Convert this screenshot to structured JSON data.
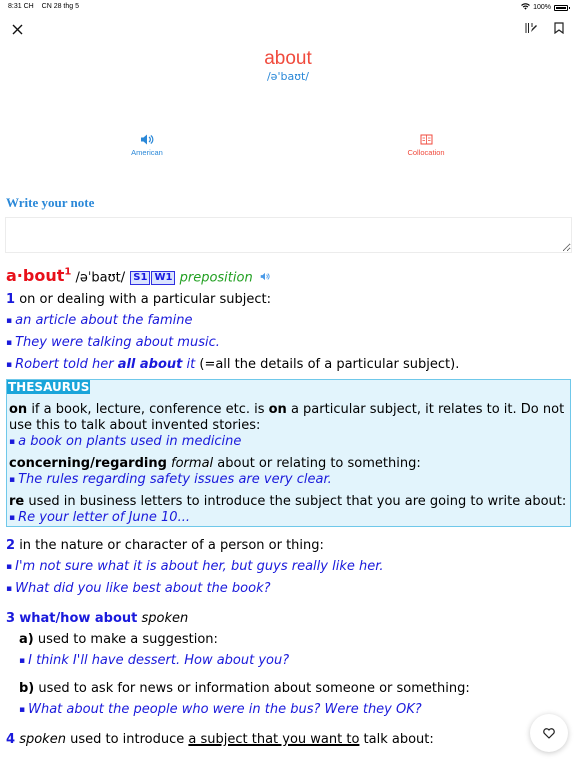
{
  "status_bar": {
    "time": "8:31 CH",
    "date": "CN 28 thg 5",
    "battery": "100%",
    "battery_level": 1.0
  },
  "toolbar": {
    "close_icon": "close-icon",
    "right_icons": [
      "flashcard-edit-icon",
      "bookmark-icon"
    ]
  },
  "header": {
    "word": "about",
    "ipa": "/ə'baʊt/"
  },
  "actions": [
    {
      "label": "American",
      "icon": "speaker-icon",
      "color": "#2a88d8"
    },
    {
      "label": "Collocation",
      "icon": "collocation-book-icon",
      "color": "#f04a3c"
    }
  ],
  "note": {
    "title": "Write your note",
    "value": "",
    "placeholder": ""
  },
  "entry": {
    "headword": "a·bout",
    "superscript": "1",
    "ipa": "/əˈbaʊt/",
    "badges": [
      "S1",
      "W1"
    ],
    "pos": "preposition",
    "senses": [
      {
        "num": "1",
        "definition": "on or dealing with a particular subject:",
        "examples": [
          "an article about the famine",
          "They were talking about music."
        ],
        "example_rich": {
          "pre": "Robert told her ",
          "bold": "all about",
          "post": " it",
          "gloss": " (=all the details of a particular subject)."
        }
      },
      {
        "num": "2",
        "definition": "in the nature or character of a person or thing:",
        "examples": [
          "I'm not sure what it is about her, but guys really like her.",
          "What did you like best about the book?"
        ]
      },
      {
        "num": "3",
        "phrase": "what/how about",
        "register": "spoken",
        "subsenses": [
          {
            "letter": "a)",
            "definition": "used to make a suggestion:",
            "examples": [
              "I think I'll have dessert. How about you?"
            ]
          },
          {
            "letter": "b)",
            "definition": "used to ask for news or information about someone or something:",
            "examples": [
              "What about the people who were in the bus? Were they OK?"
            ]
          }
        ]
      },
      {
        "num": "4",
        "register": "spoken",
        "definition_pre": "used to introduce ",
        "definition_marked": "a subject that you want to",
        "definition_post": " talk about:"
      }
    ],
    "thesaurus": {
      "label": "THESAURUS",
      "items": [
        {
          "word": "on",
          "text_1": " if a book, lecture, conference etc. is ",
          "word2": "on",
          "text_2": " a particular subject, it relates to it. Do not use this to talk about invented stories:",
          "example": "a book on plants used in medicine"
        },
        {
          "word": "concerning/regarding",
          "register": "formal",
          "text_1": " about or relating to something:",
          "example": "The rules regarding safety issues are very clear."
        },
        {
          "word": "re",
          "text_1": " used in business letters to introduce the subject that you are going to write about:",
          "example": "Re your letter of June 10..."
        }
      ]
    }
  },
  "favorite_button": {
    "icon": "heart-icon"
  },
  "colors": {
    "headword_red": "#f04a3c",
    "ipa_blue": "#2a88d8",
    "example_blue": "#1a1adb",
    "pos_green": "#22a022",
    "thesaurus_bg": "#e2f4fc",
    "thesaurus_label": "#1aa5da"
  }
}
